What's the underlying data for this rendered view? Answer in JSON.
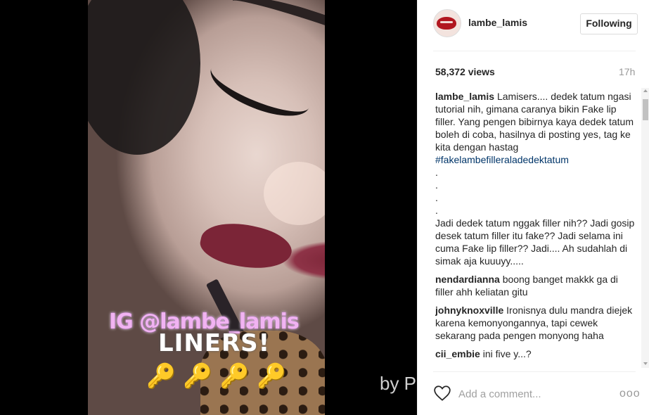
{
  "media": {
    "overlay_ig": "IG @lambe_lamis",
    "overlay_liners": "LINERS!",
    "keys": "🔑🔑🔑🔑",
    "watermark": "by P"
  },
  "post": {
    "username": "lambe_lamis",
    "follow_label": "Following",
    "views": "58,372 views",
    "time": "17h"
  },
  "caption": {
    "user": "lambe_lamis",
    "text1": "Lamisers.... dedek tatum ngasi tutorial nih, gimana caranya bikin Fake lip filler. Yang pengen bibirnya kaya dedek tatum boleh di coba, hasilnya di posting yes, tag ke kita dengan hastag",
    "hashtag": "#fakelambefilleraladedektatum",
    "dots": [
      ".",
      ".",
      ".",
      "."
    ],
    "text2": "Jadi dedek tatum nggak filler nih?? Jadi gosip desek tatum filler itu fake?? Jadi selama ini cuma Fake lip filler?? Jadi.... Ah sudahlah di simak aja kuuuyy....."
  },
  "comments": [
    {
      "user": "nendardianna",
      "text": "boong banget makkk ga di filler ahh keliatan gitu"
    },
    {
      "user": "johnyknoxville",
      "text": "Ironisnya dulu mandra diejek karena kemonyongannya, tapi cewek sekarang pada pengen monyong haha"
    },
    {
      "user": "cii_embie",
      "text": "ini five y...?"
    }
  ],
  "footer": {
    "comment_placeholder": "Add a comment...",
    "more_label": "ooo"
  },
  "icons": {
    "heart": "heart-icon",
    "more": "more-options-icon"
  }
}
